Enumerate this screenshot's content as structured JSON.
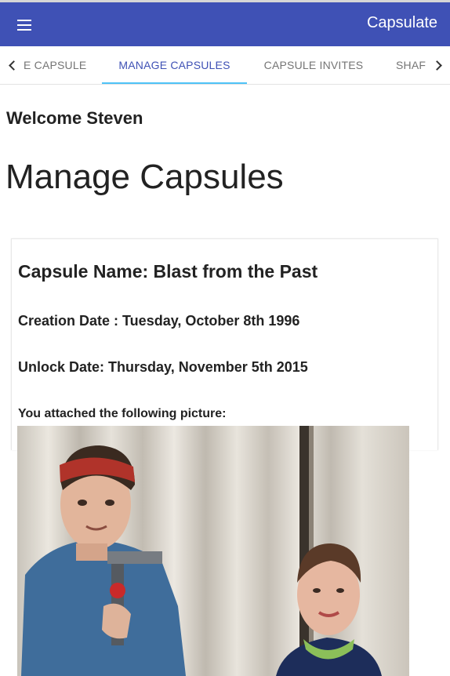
{
  "app": {
    "title": "Capsulate"
  },
  "colors": {
    "appbar": "#3f51b5",
    "tab_active": "#3f51b5",
    "tab_indicator": "#4fc3f7"
  },
  "tabs": [
    {
      "label": "E CAPSULE",
      "active": false
    },
    {
      "label": "MANAGE CAPSULES",
      "active": true
    },
    {
      "label": "CAPSULE INVITES",
      "active": false
    },
    {
      "label": "SHAF",
      "active": false
    }
  ],
  "welcome": "Welcome Steven",
  "page_title": "Manage Capsules",
  "capsule": {
    "name": "Capsule Name: Blast from the Past",
    "creation_date": "Creation Date : Tuesday, October 8th 1996",
    "unlock_date": "Unlock Date: Thursday, November 5th 2015",
    "attachment_label": "You attached the following picture:"
  },
  "icons": {
    "menu": "hamburger-menu-icon",
    "scroll_left": "chevron-left-icon",
    "scroll_right": "chevron-right-icon"
  }
}
